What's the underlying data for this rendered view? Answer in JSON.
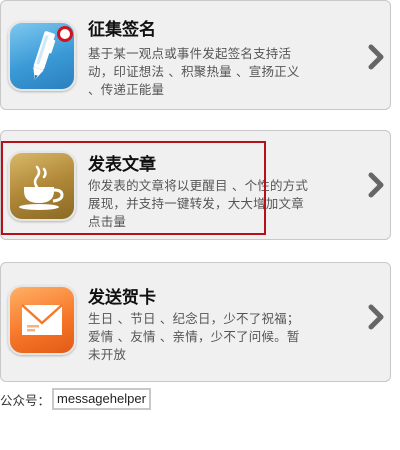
{
  "cards": [
    {
      "title": "征集签名",
      "description": "基于某一观点或事件发起签名支持活动，印证想法 、积聚热量 、宣扬正义 、传递正能量",
      "icon": "pen-signature-icon",
      "accent": "#3a9ad6"
    },
    {
      "title": "发表文章",
      "description": "你发表的文章将以更醒目 、个性的方式展现，并支持一键转发，大大增加文章点击量",
      "icon": "coffee-cup-icon",
      "accent": "#b08838"
    },
    {
      "title": "发送贺卡",
      "description": "生日 、节日 、纪念日，少不了祝福；爱情 、友情 、亲情，少不了问候。暂未开放",
      "icon": "envelope-icon",
      "accent": "#f7782a"
    }
  ],
  "footer": {
    "label": "公众号：",
    "account_id": "messagehelper"
  },
  "colors": {
    "highlight": "#b5111a",
    "card_background": "#f0f0f0",
    "chevron": "#666666"
  }
}
